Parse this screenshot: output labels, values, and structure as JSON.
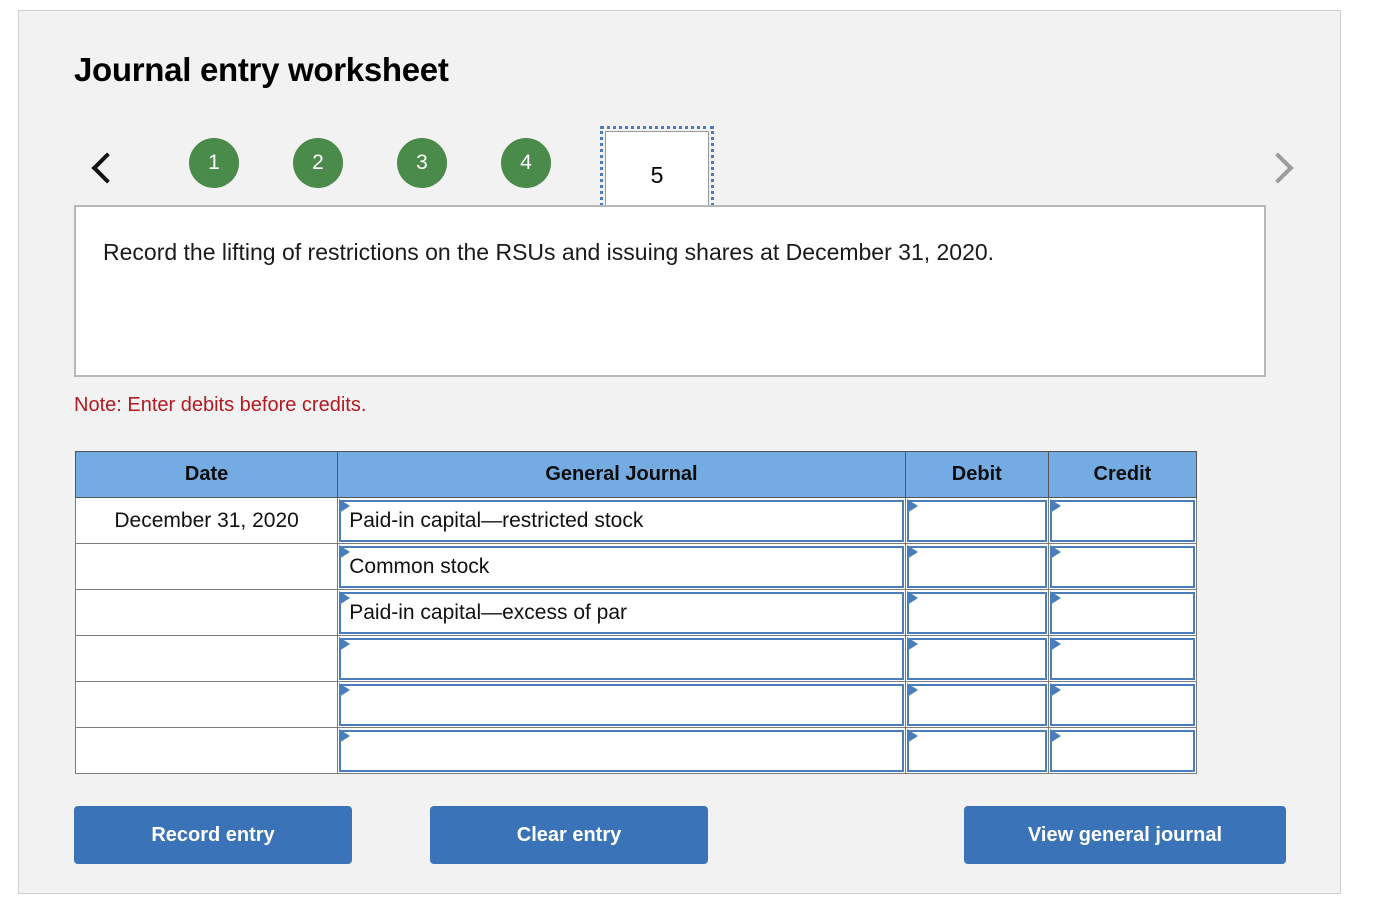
{
  "worksheet": {
    "title": "Journal entry worksheet",
    "instruction": "Record the lifting of restrictions on the RSUs and issuing shares at December 31, 2020.",
    "note": "Note: Enter debits before credits."
  },
  "pager": {
    "prev_icon": "chevron-left-icon",
    "next_icon": "chevron-right-icon",
    "steps": [
      {
        "label": "1",
        "state": "completed"
      },
      {
        "label": "2",
        "state": "completed"
      },
      {
        "label": "3",
        "state": "completed"
      },
      {
        "label": "4",
        "state": "completed"
      }
    ],
    "current_step": "5"
  },
  "table": {
    "headers": {
      "date": "Date",
      "general_journal": "General Journal",
      "debit": "Debit",
      "credit": "Credit"
    },
    "rows": [
      {
        "date": "December 31, 2020",
        "account": "Paid-in capital—restricted stock",
        "debit": "",
        "credit": ""
      },
      {
        "date": "",
        "account": "Common stock",
        "debit": "",
        "credit": ""
      },
      {
        "date": "",
        "account": "Paid-in capital—excess of par",
        "debit": "",
        "credit": ""
      },
      {
        "date": "",
        "account": "",
        "debit": "",
        "credit": ""
      },
      {
        "date": "",
        "account": "",
        "debit": "",
        "credit": ""
      },
      {
        "date": "",
        "account": "",
        "debit": "",
        "credit": ""
      }
    ]
  },
  "buttons": {
    "record": "Record entry",
    "clear": "Clear entry",
    "view": "View general journal"
  },
  "colors": {
    "panel_bg": "#f2f2f2",
    "step_green": "#4a8a4a",
    "header_blue": "#74abe2",
    "field_blue": "#4a7ebb",
    "button_blue": "#3b73b9",
    "note_red": "#b01b23"
  }
}
